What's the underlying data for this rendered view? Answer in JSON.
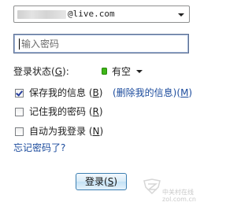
{
  "account": {
    "email_visible": "@live.com",
    "dropdown_icon": "chevron-down-icon"
  },
  "password": {
    "placeholder": "输入密码"
  },
  "status": {
    "label": "登录状态",
    "accel": "G",
    "value": "有空",
    "color": "#3fb618"
  },
  "options": {
    "save_info": {
      "label": "保存我的信息",
      "accel": "B",
      "checked": true
    },
    "delete_info_link": "(删除我的信息)",
    "delete_info_accel": "M",
    "remember_pwd": {
      "label": "记住我的密码",
      "accel": "R",
      "checked": false
    },
    "auto_login": {
      "label": "自动为我登录",
      "accel": "N",
      "checked": false
    }
  },
  "forgot_link": "忘记密码了?",
  "login_button": {
    "label": "登录",
    "accel": "S"
  },
  "watermark": {
    "line1": "中关村在线",
    "line2": "zol.com.cn"
  },
  "colors": {
    "link": "#1a4a9c",
    "button_border": "#3c7fb1"
  }
}
